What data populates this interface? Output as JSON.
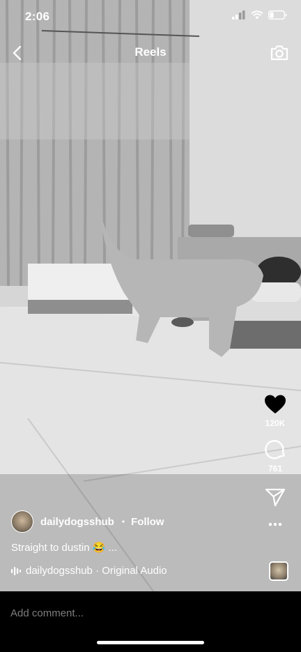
{
  "status_bar": {
    "time": "2:06"
  },
  "header": {
    "title": "Reels"
  },
  "actions": {
    "likes": "120K",
    "comments": "761"
  },
  "post": {
    "username": "dailydogsshub",
    "separator": "•",
    "follow_label": "Follow",
    "caption": "Straight to dustin 😂 ...",
    "audio": "dailydogsshub · Original Audio"
  },
  "comment_bar": {
    "placeholder": "Add comment..."
  }
}
